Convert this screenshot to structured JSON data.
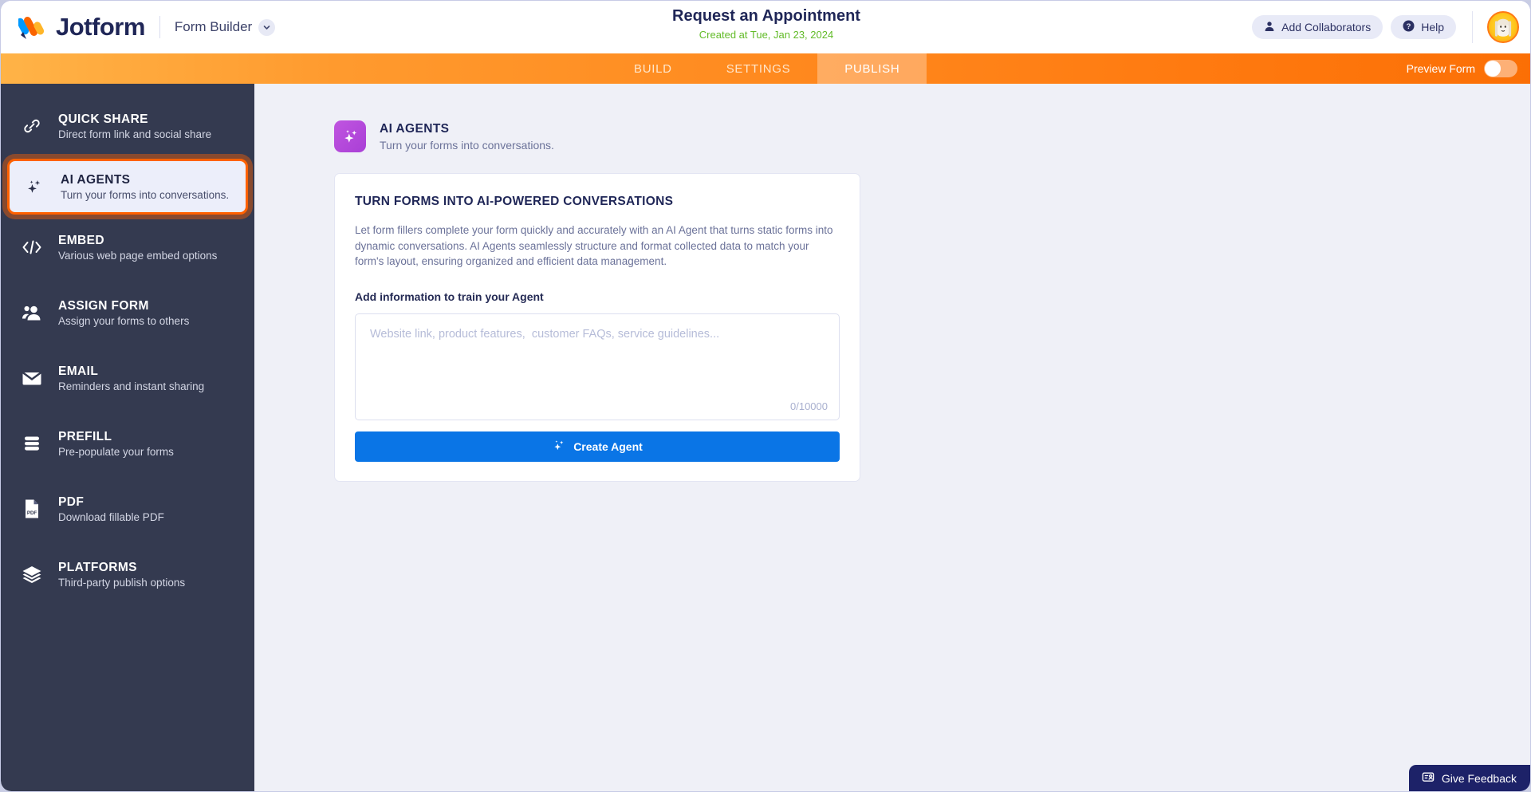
{
  "header": {
    "brand": "Jotform",
    "product": "Form Builder",
    "form_title": "Request an Appointment",
    "form_created": "Created at Tue, Jan 23, 2024",
    "add_collaborators": "Add Collaborators",
    "help": "Help",
    "logo_icon": "jotform-logo-icon",
    "chevron_icon": "chevron-down-icon",
    "collaborators_icon": "person-icon",
    "help_icon": "question-circle-icon",
    "avatar_icon": "user-avatar"
  },
  "tabbar": {
    "tabs": [
      {
        "label": "BUILD",
        "active": false
      },
      {
        "label": "SETTINGS",
        "active": false
      },
      {
        "label": "PUBLISH",
        "active": true
      }
    ],
    "preview_label": "Preview Form",
    "preview_enabled": false
  },
  "sidebar": {
    "items": [
      {
        "title": "QUICK SHARE",
        "sub": "Direct form link and social share",
        "icon": "link-icon",
        "selected": false
      },
      {
        "title": "AI AGENTS",
        "sub": "Turn your forms into conversations.",
        "icon": "sparkle-icon",
        "selected": true
      },
      {
        "title": "EMBED",
        "sub": "Various web page embed options",
        "icon": "code-brackets-icon",
        "selected": false
      },
      {
        "title": "ASSIGN FORM",
        "sub": "Assign your forms to others",
        "icon": "people-icon",
        "selected": false
      },
      {
        "title": "EMAIL",
        "sub": "Reminders and instant sharing",
        "icon": "envelope-icon",
        "selected": false
      },
      {
        "title": "PREFILL",
        "sub": "Pre-populate your forms",
        "icon": "stack-lines-icon",
        "selected": false
      },
      {
        "title": "PDF",
        "sub": "Download fillable PDF",
        "icon": "pdf-file-icon",
        "selected": false
      },
      {
        "title": "PLATFORMS",
        "sub": "Third-party publish options",
        "icon": "layers-icon",
        "selected": false
      }
    ]
  },
  "main": {
    "section_title": "AI AGENTS",
    "section_sub": "Turn your forms into conversations.",
    "section_icon": "sparkle-icon",
    "card": {
      "title": "TURN FORMS INTO AI-POWERED CONVERSATIONS",
      "description": "Let form fillers complete your form quickly and accurately with an AI Agent that turns static forms into dynamic conversations. AI Agents seamlessly structure and format collected data to match your form's layout, ensuring organized and efficient data management.",
      "field_label": "Add information to train your Agent",
      "textarea_value": "",
      "textarea_placeholder": "Website link, product features,  customer FAQs, service guidelines...",
      "counter": "0/10000",
      "create_button": "Create Agent",
      "create_button_icon": "sparkle-icon"
    }
  },
  "feedback": {
    "label": "Give Feedback",
    "icon": "feedback-card-icon"
  },
  "colors": {
    "brand_navy": "#1f2657",
    "orange": "#ff6100",
    "sidebar_bg": "#343a50",
    "page_bg": "#eff0f7",
    "accent_blue": "#0a75e6",
    "purple": "#b14ad8",
    "green": "#62bb28"
  }
}
